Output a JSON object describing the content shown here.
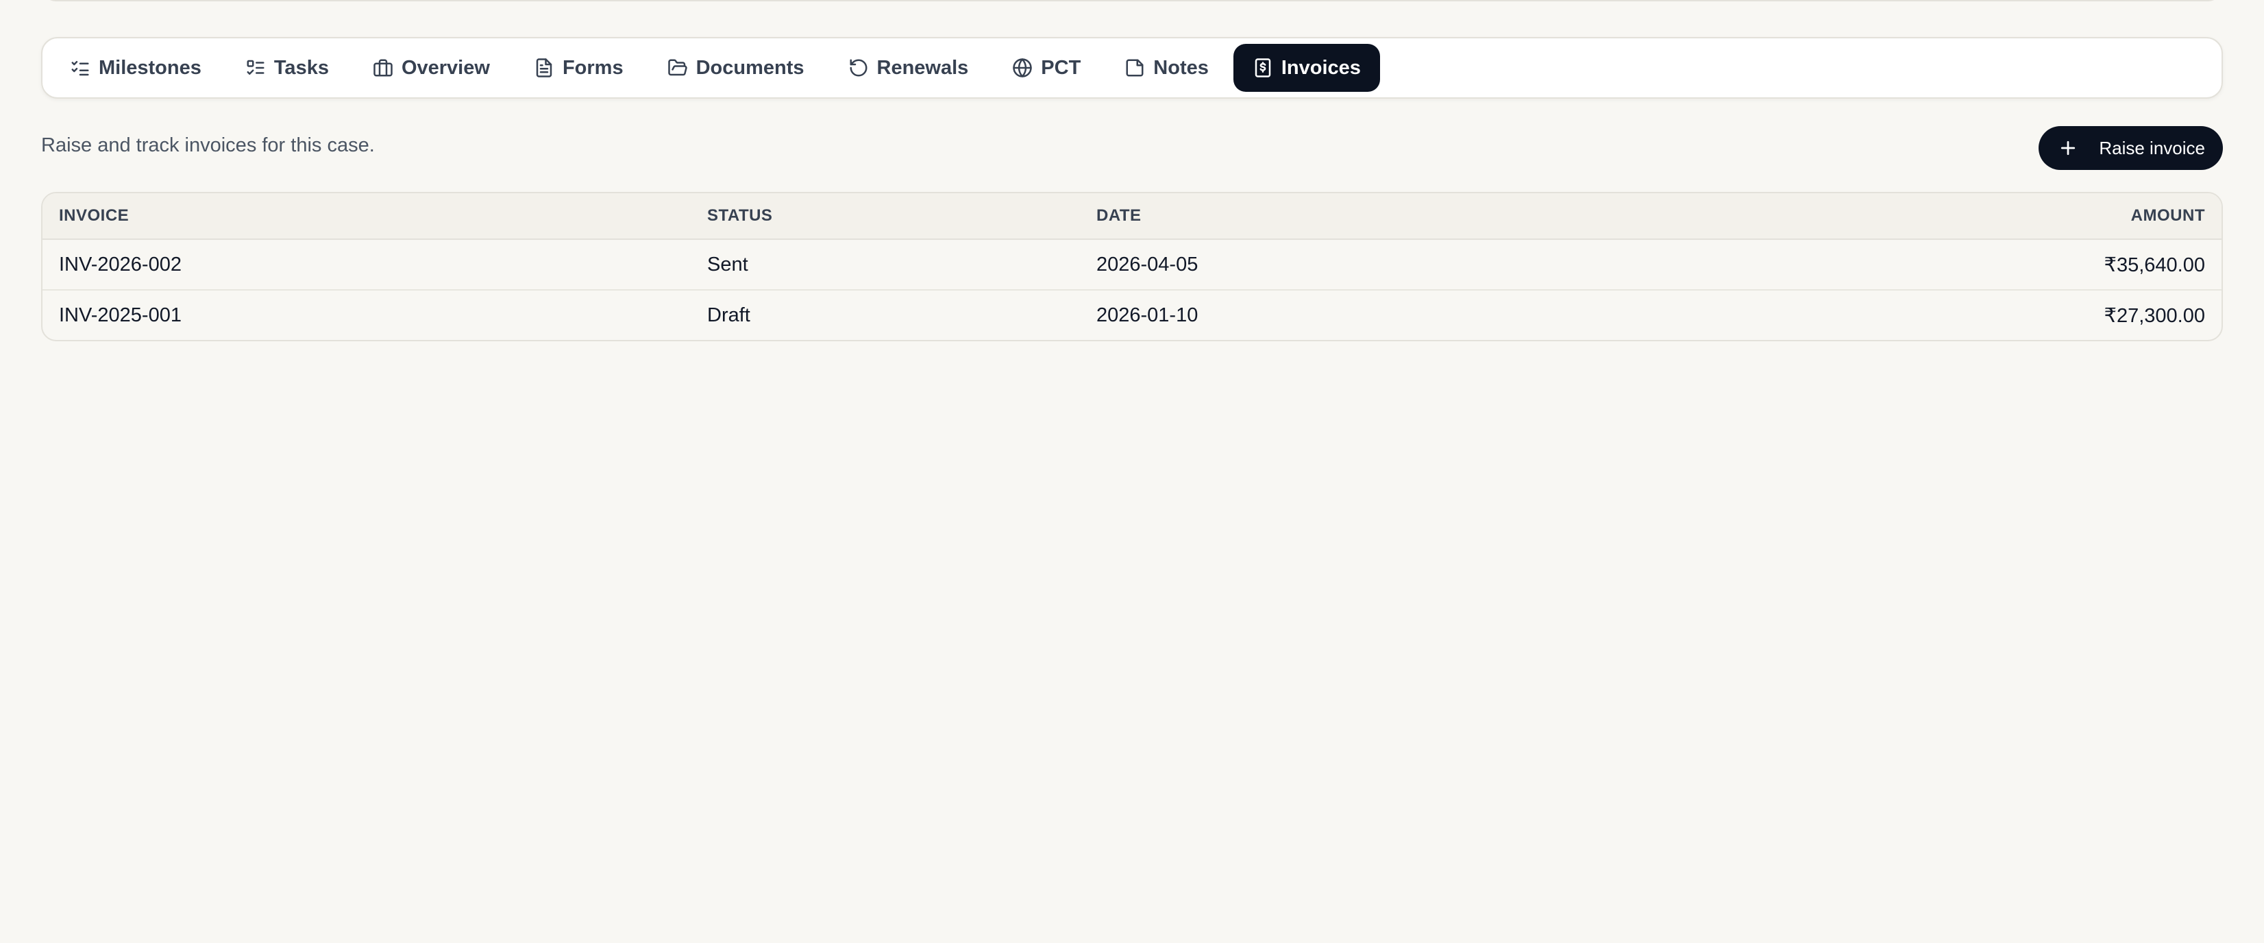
{
  "tabs": [
    {
      "label": "Milestones",
      "icon": "list-checks-icon"
    },
    {
      "label": "Tasks",
      "icon": "list-todo-icon"
    },
    {
      "label": "Overview",
      "icon": "briefcase-icon"
    },
    {
      "label": "Forms",
      "icon": "file-text-icon"
    },
    {
      "label": "Documents",
      "icon": "folder-open-icon"
    },
    {
      "label": "Renewals",
      "icon": "rotate-ccw-icon"
    },
    {
      "label": "PCT",
      "icon": "globe-icon"
    },
    {
      "label": "Notes",
      "icon": "sticky-note-icon"
    },
    {
      "label": "Invoices",
      "icon": "receipt-icon",
      "active": true
    }
  ],
  "invoices": {
    "description": "Raise and track invoices for this case.",
    "raise_label": "Raise invoice",
    "columns": {
      "invoice": "INVOICE",
      "status": "STATUS",
      "date": "DATE",
      "amount": "AMOUNT"
    },
    "rows": [
      {
        "invoice": "INV-2026-002",
        "status": "Sent",
        "date": "2026-04-05",
        "amount": "₹35,640.00"
      },
      {
        "invoice": "INV-2025-001",
        "status": "Draft",
        "date": "2026-01-10",
        "amount": "₹27,300.00"
      }
    ]
  },
  "colors": {
    "background": "#f8f7f3",
    "active_tab": "#0b1220",
    "border": "#e3e1da"
  }
}
